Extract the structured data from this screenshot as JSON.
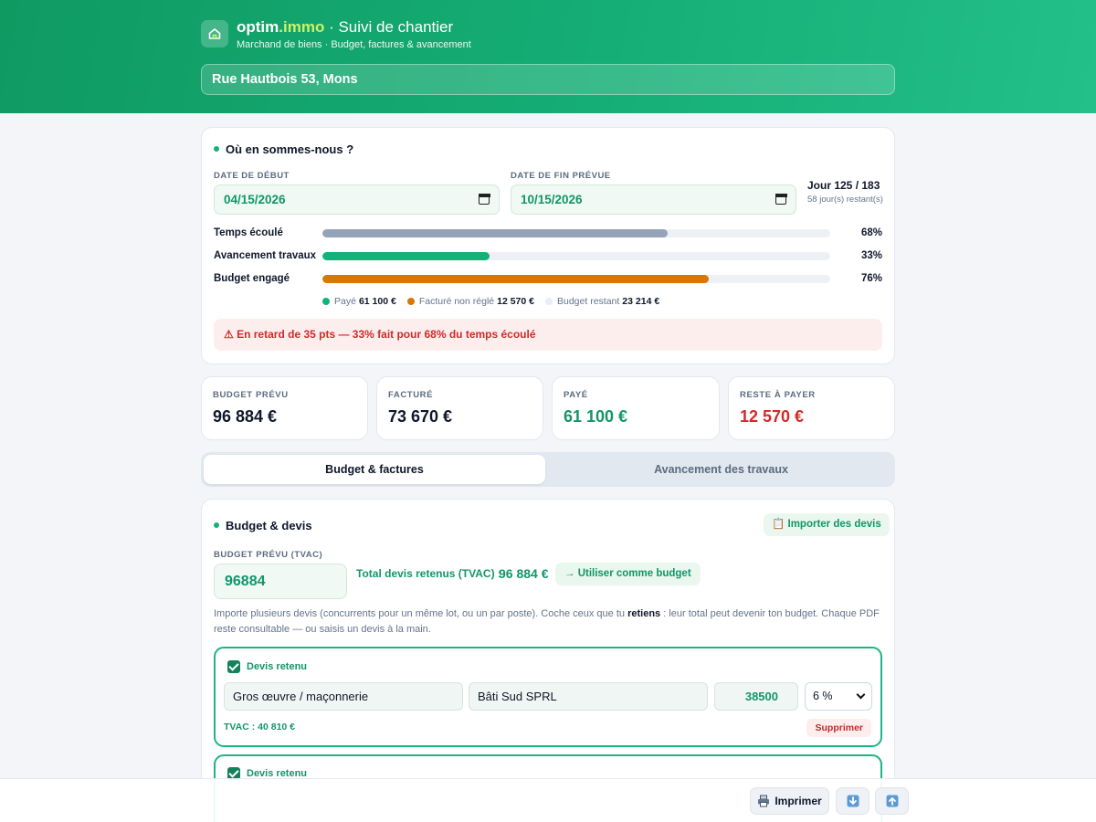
{
  "header": {
    "brand_part1": "optim",
    "brand_part2": ".immo",
    "brand_part3": " · Suivi de chantier",
    "subtitle": "Marchand de biens · Budget, factures & avancement",
    "address": "Rue Hautbois 53, Mons",
    "logo_icon": "house-icon"
  },
  "status": {
    "title": "Où en sommes-nous ?",
    "start_label": "DATE DE DÉBUT",
    "start_value": "04/15/2026",
    "end_label": "DATE DE FIN PRÉVUE",
    "end_value": "10/15/2026",
    "day_counter": "Jour 125 / 183",
    "days_left": "58 jour(s) restant(s)",
    "progress": [
      {
        "label": "Temps écoulé",
        "percent": 68,
        "percent_text": "68%",
        "color": "#94a3b8"
      },
      {
        "label": "Avancement travaux",
        "percent": 33,
        "percent_text": "33%",
        "color": "#12b27a"
      },
      {
        "label": "Budget engagé",
        "percent": 76,
        "percent_text": "76%",
        "color": "#d97706"
      }
    ],
    "legend": [
      {
        "label": "Payé",
        "value": "61 100 €",
        "color": "#12b27a"
      },
      {
        "label": "Facturé non réglé",
        "value": "12 570 €",
        "color": "#d97706"
      },
      {
        "label": "Budget restant",
        "value": "23 214 €",
        "color": "#e8eef5"
      }
    ],
    "alert": "⚠ En retard de 35 pts — 33% fait pour 68% du temps écoulé"
  },
  "kpis": [
    {
      "label": "BUDGET PRÉVU",
      "value": "96 884 €",
      "color": "#0f172a"
    },
    {
      "label": "FACTURÉ",
      "value": "73 670 €",
      "color": "#0f172a"
    },
    {
      "label": "PAYÉ",
      "value": "61 100 €",
      "color": "#12966a"
    },
    {
      "label": "RESTE À PAYER",
      "value": "12 570 €",
      "color": "#d22a2a"
    }
  ],
  "tabs": {
    "active": "Budget & factures",
    "inactive": "Avancement des travaux"
  },
  "budget": {
    "title": "Budget & devis",
    "import_button": "📋 Importer des devis",
    "budget_label": "BUDGET PRÉVU (TVAC)",
    "budget_value": "96884",
    "total_label": "Total devis retenus (TVAC) :",
    "total_value": "96 884 €",
    "use_button": "→ Utiliser comme budget",
    "help_part1": "Importe plusieurs devis (concurrents pour un même lot, ou un par poste). Coche ceux que tu ",
    "help_bold": "retiens",
    "help_part2": " : leur total peut devenir ton budget. Chaque PDF reste consultable — ou saisis un devis à la main.",
    "devis": [
      {
        "retained_label": "Devis retenu",
        "poste": "Gros œuvre / maçonnerie",
        "entreprise": "Bâti Sud SPRL",
        "montant": "38500",
        "tva": "6 %",
        "tvac": "TVAC : 40 810 €",
        "delete": "Supprimer"
      },
      {
        "retained_label": "Devis retenu"
      }
    ]
  },
  "footer": {
    "print_label": "Imprimer",
    "print_icon": "printer-icon",
    "download_icon": "download-icon",
    "upload_icon": "upload-icon"
  }
}
